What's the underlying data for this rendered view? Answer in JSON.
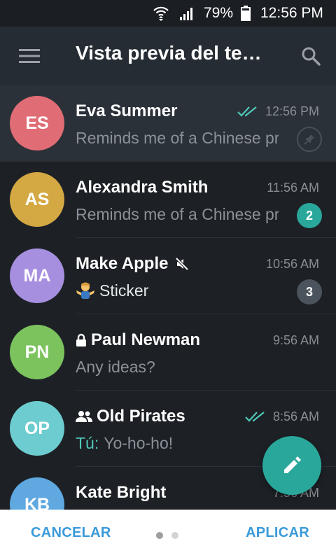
{
  "status_bar": {
    "battery": "79%",
    "time": "12:56 PM"
  },
  "toolbar": {
    "title": "Vista previa del te…"
  },
  "chats": [
    {
      "initials": "ES",
      "name": "Eva Summer",
      "time": "12:56 PM",
      "preview": "Reminds me of a Chinese prove…",
      "read": true,
      "pinned": true,
      "avatar_color": "#e06c75"
    },
    {
      "initials": "AS",
      "name": "Alexandra Smith",
      "time": "11:56 AM",
      "preview": "Reminds me of a Chinese prove…",
      "unread": "2",
      "badge_color": "#2aa79b",
      "avatar_color": "#d4a843"
    },
    {
      "initials": "MA",
      "name": "Make Apple",
      "time": "10:56 AM",
      "preview": "Sticker",
      "unread": "3",
      "badge_color": "#4b535c",
      "muted": true,
      "avatar_color": "#a78fe0"
    },
    {
      "initials": "PN",
      "name": "Paul Newman",
      "time": "9:56 AM",
      "preview": "Any ideas?",
      "secret": true,
      "avatar_color": "#7cc35e"
    },
    {
      "initials": "OP",
      "name": "Old Pirates",
      "time": "8:56 AM",
      "sender": "Tú:",
      "preview": "Yo-ho-ho!",
      "group": true,
      "read": true,
      "avatar_color": "#6ccccf"
    },
    {
      "initials": "KB",
      "name": "Kate Bright",
      "time": "7:56 AM",
      "avatar_color": "#5fa8e0"
    }
  ],
  "bottom": {
    "cancel": "CANCELAR",
    "apply": "APLICAR"
  },
  "colors": {
    "accent": "#2aa79b",
    "link": "#3a9ad9",
    "background": "#1d2126",
    "toolbar": "#262c33"
  }
}
